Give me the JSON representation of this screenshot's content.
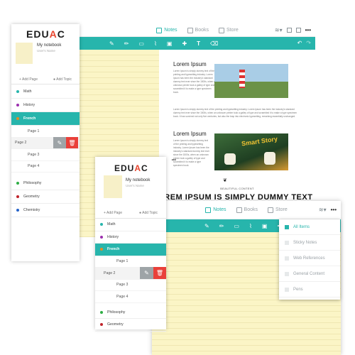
{
  "app": {
    "logo_prefix": "EDU",
    "logo_a": "A",
    "logo_suffix": "C"
  },
  "notebook": {
    "title": "My notebook",
    "subtitle": "User's Name"
  },
  "actions": {
    "add_page": "Add Page",
    "add_topic": "Add Topic"
  },
  "sidebar_back": {
    "items": [
      {
        "label": "Math",
        "color": "#27b5ac"
      },
      {
        "label": "History",
        "color": "#9b2fae"
      },
      {
        "label": "French",
        "color": "#e58a23",
        "active": true
      }
    ],
    "pages": [
      "Page 1",
      "Page 2",
      "Page 3",
      "Page 4"
    ],
    "items_after": [
      {
        "label": "Philosophy",
        "color": "#2fae45"
      },
      {
        "label": "Geometry",
        "color": "#c0242b"
      },
      {
        "label": "Chemistry",
        "color": "#2563c9"
      }
    ]
  },
  "sidebar_front": {
    "items": [
      {
        "label": "Math",
        "color": "#27b5ac"
      },
      {
        "label": "History",
        "color": "#9b2fae"
      },
      {
        "label": "French",
        "color": "#e58a23",
        "active": true
      }
    ],
    "pages": [
      "Page 1",
      "Page 2",
      "Page 3",
      "Page 4"
    ],
    "items_after": [
      {
        "label": "Philosophy",
        "color": "#2fae45"
      },
      {
        "label": "Geometry",
        "color": "#c0242b"
      }
    ]
  },
  "tabs": {
    "notes": "Notes",
    "books": "Books",
    "store": "Store"
  },
  "article": {
    "heading1": "Lorem Ipsum",
    "heading2": "Lorem Ipsum",
    "para1": "Lorem Ipsum is simply dummy text of the printing and typesetting industry. Lorem Ipsum has been the industry's standard dummy text ever since the 1500s, when an unknown printer took a galley of type and scrambled it to make a type specimen book.",
    "para2": "Lorem Ipsum is simply dummy text of the printing and typesetting industry. Lorem Ipsum has been the industry's standard dummy text ever since the 1500s, when an unknown printer took a galley of type and scrambled it to make a type specimen book. It has survived not only five centuries, but also the leap into electronic typesetting, remaining essentially unchanged.",
    "para3": "Lorem Ipsum is simply dummy text of the printing and typesetting industry. Lorem Ipsum has been the industry's standard dummy text ever since the 1500s, when an unknown printer took a galley of type and scrambled it to make a type specimen book.",
    "image2_text": "Smart Story",
    "caption": "BEAUTIFUL CONTENT",
    "big_title": "LOREM IPSUM IS SIMPLY DUMMY TEXT"
  },
  "filter_menu": {
    "items": [
      {
        "label": "All Items",
        "checked": true
      },
      {
        "label": "Sticky Notes",
        "checked": false
      },
      {
        "label": "Web References",
        "checked": false
      },
      {
        "label": "General Content",
        "checked": false
      },
      {
        "label": "Pens",
        "checked": false
      }
    ]
  },
  "colors": {
    "accent": "#27b5ac",
    "danger": "#e9403a",
    "paper": "#fbf5c6"
  }
}
